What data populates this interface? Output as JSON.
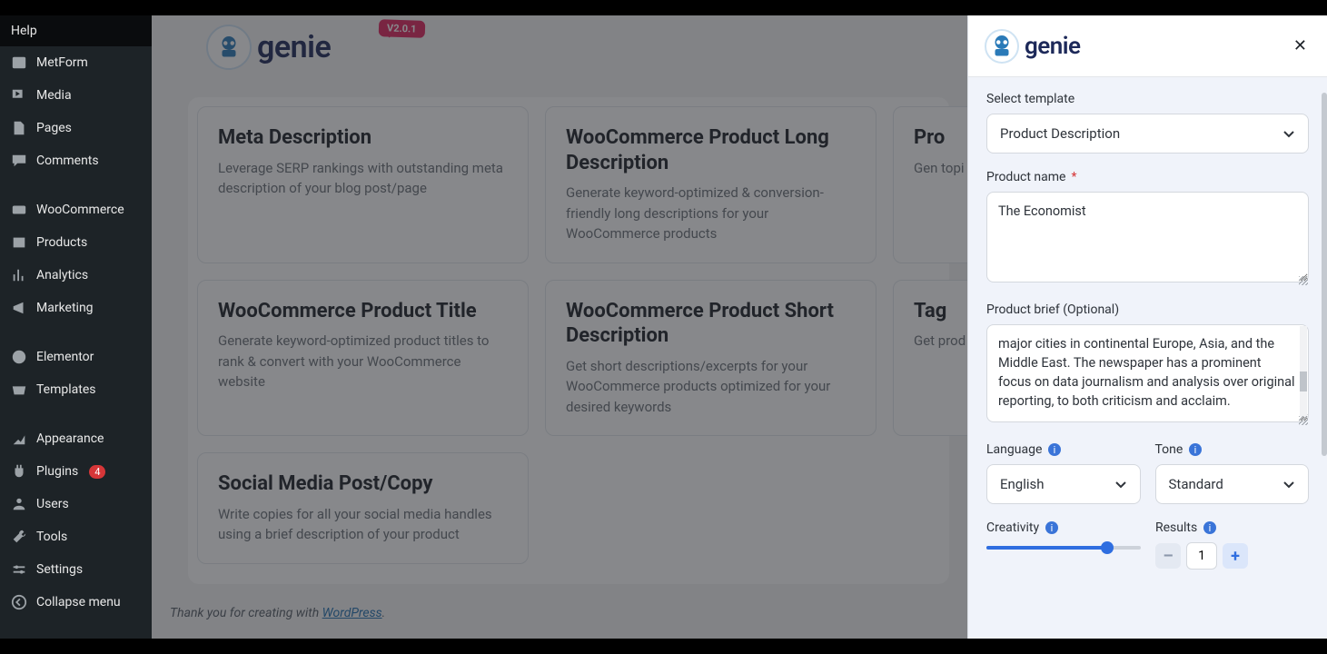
{
  "sidebar": {
    "help": "Help",
    "items": [
      {
        "label": "MetForm"
      },
      {
        "label": "Media"
      },
      {
        "label": "Pages"
      },
      {
        "label": "Comments"
      },
      {
        "label": "WooCommerce"
      },
      {
        "label": "Products"
      },
      {
        "label": "Analytics"
      },
      {
        "label": "Marketing"
      },
      {
        "label": "Elementor"
      },
      {
        "label": "Templates"
      },
      {
        "label": "Appearance"
      },
      {
        "label": "Plugins",
        "badge": "4"
      },
      {
        "label": "Users"
      },
      {
        "label": "Tools"
      },
      {
        "label": "Settings"
      },
      {
        "label": "Collapse menu"
      }
    ]
  },
  "header": {
    "brand": "genie",
    "version": "V2.0.1"
  },
  "cards": [
    {
      "title": "Meta Description",
      "desc": "Leverage SERP rankings with outstanding meta description of your blog post/page"
    },
    {
      "title": "WooCommerce Product Long Description",
      "desc": "Generate keyword-optimized & conversion-friendly long descriptions for your WooCommerce products"
    },
    {
      "title": "Pro",
      "desc": "Gen topi"
    },
    {
      "title": "WooCommerce Product Title",
      "desc": "Generate keyword-optimized product titles to rank & convert with your WooCommerce website"
    },
    {
      "title": "WooCommerce Product Short Description",
      "desc": "Get short descriptions/excerpts for your WooCommerce products optimized for your desired keywords"
    },
    {
      "title": "Tag",
      "desc": "Get prod"
    },
    {
      "title": "Social Media Post/Copy",
      "desc": "Write copies for all your social media handles using a brief description of your product"
    }
  ],
  "footer": {
    "prefix": "Thank you for creating with ",
    "link": "WordPress",
    "suffix": "."
  },
  "panel": {
    "select_template_label": "Select template",
    "select_template_value": "Product Description",
    "product_name_label": "Product name",
    "product_name_value": "The Economist",
    "product_brief_label": "Product brief (Optional)",
    "product_brief_value": "major cities in continental Europe, Asia, and the Middle East. The newspaper has a prominent focus on data journalism and analysis over original reporting, to both criticism and acclaim.",
    "language_label": "Language",
    "language_value": "English",
    "tone_label": "Tone",
    "tone_value": "Standard",
    "creativity_label": "Creativity",
    "results_label": "Results",
    "results_value": "1"
  }
}
